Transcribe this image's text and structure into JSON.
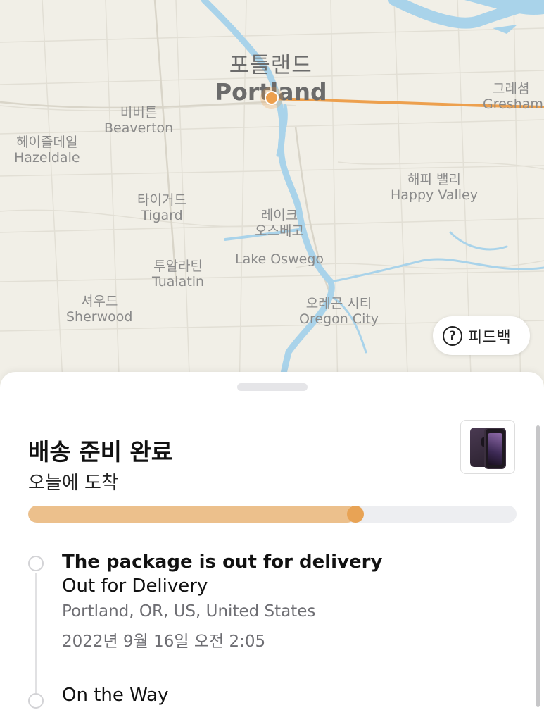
{
  "map": {
    "cities": {
      "portland": {
        "ko": "포틀랜드",
        "en": "Portland"
      },
      "gresham": {
        "ko": "그레셤",
        "en": "Gresham"
      },
      "beaverton": {
        "ko": "비버튼",
        "en": "Beaverton"
      },
      "hazeldale": {
        "ko": "헤이즐데일",
        "en": "Hazeldale"
      },
      "tigard": {
        "ko": "타이거드",
        "en": "Tigard"
      },
      "lake_oswego": {
        "ko": "레이크\n오스베고",
        "en": "Lake Oswego"
      },
      "happy_valley": {
        "ko": "해피 밸리",
        "en": "Happy Valley"
      },
      "tualatin": {
        "ko": "투알라틴",
        "en": "Tualatin"
      },
      "sherwood": {
        "ko": "셔우드",
        "en": "Sherwood"
      },
      "oregon_city": {
        "ko": "오레곤 시티",
        "en": "Oregon City"
      }
    },
    "feedback_label": "피드백",
    "colors": {
      "route": "#eda04e",
      "water": "#a9d3ea",
      "land": "#f1efe7"
    }
  },
  "delivery": {
    "status_title": "배송 준비 완료",
    "arrival": "오늘에 도착",
    "progress": 0.67,
    "product_image": "iphone-14-pro-deep-purple"
  },
  "events": [
    {
      "title": "The package is out for delivery",
      "status": "Out for Delivery",
      "location": "Portland, OR, US, United States",
      "time": "2022년 9월 16일  오전 2:05"
    },
    {
      "title": "On the Way"
    }
  ]
}
